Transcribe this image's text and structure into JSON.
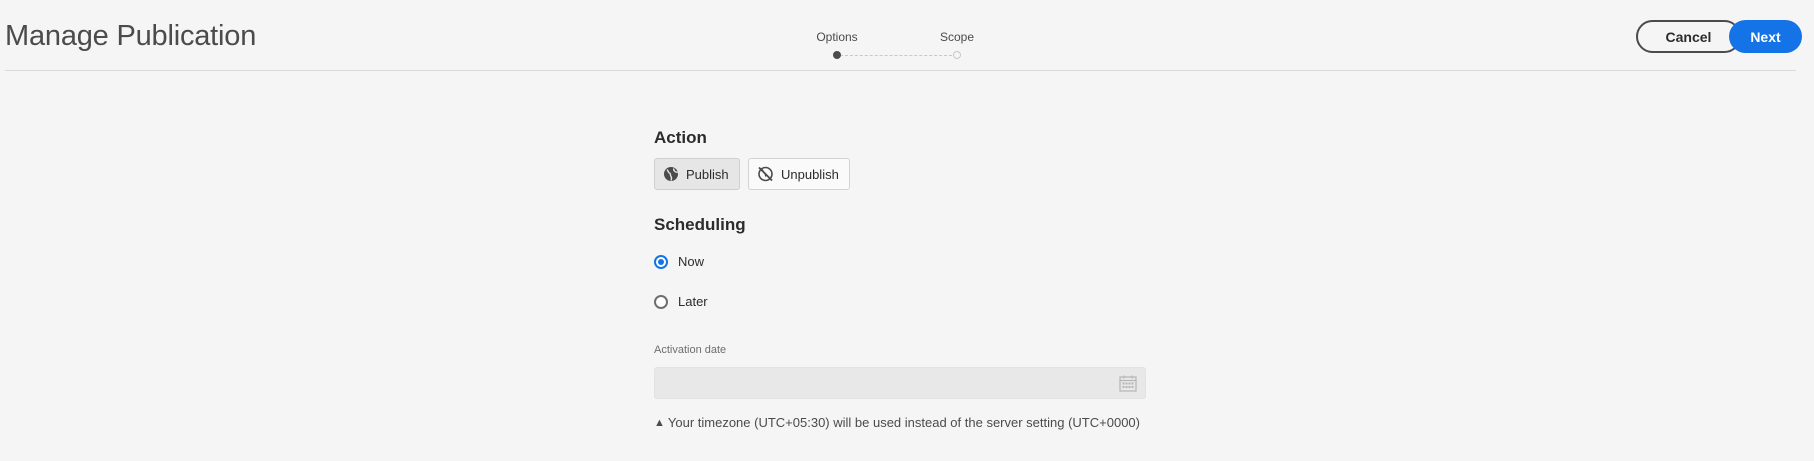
{
  "header": {
    "title": "Manage Publication",
    "cancel_label": "Cancel",
    "next_label": "Next"
  },
  "stepper": {
    "steps": [
      {
        "label": "Options",
        "active": true
      },
      {
        "label": "Scope",
        "active": false
      }
    ]
  },
  "action": {
    "heading": "Action",
    "publish_label": "Publish",
    "unpublish_label": "Unpublish",
    "selected": "Publish"
  },
  "scheduling": {
    "heading": "Scheduling",
    "options": [
      {
        "label": "Now",
        "checked": true
      },
      {
        "label": "Later",
        "checked": false
      }
    ]
  },
  "activation": {
    "label": "Activation date",
    "value": "",
    "placeholder": ""
  },
  "timezone_note": "Your timezone (UTC+05:30) will be used instead of the server setting (UTC+0000)",
  "colors": {
    "accent": "#1473e6",
    "background": "#f5f5f5",
    "text": "#2c2c2c"
  },
  "icons": [
    "globe-icon",
    "globe-off-icon",
    "calendar-icon",
    "warning-icon"
  ]
}
